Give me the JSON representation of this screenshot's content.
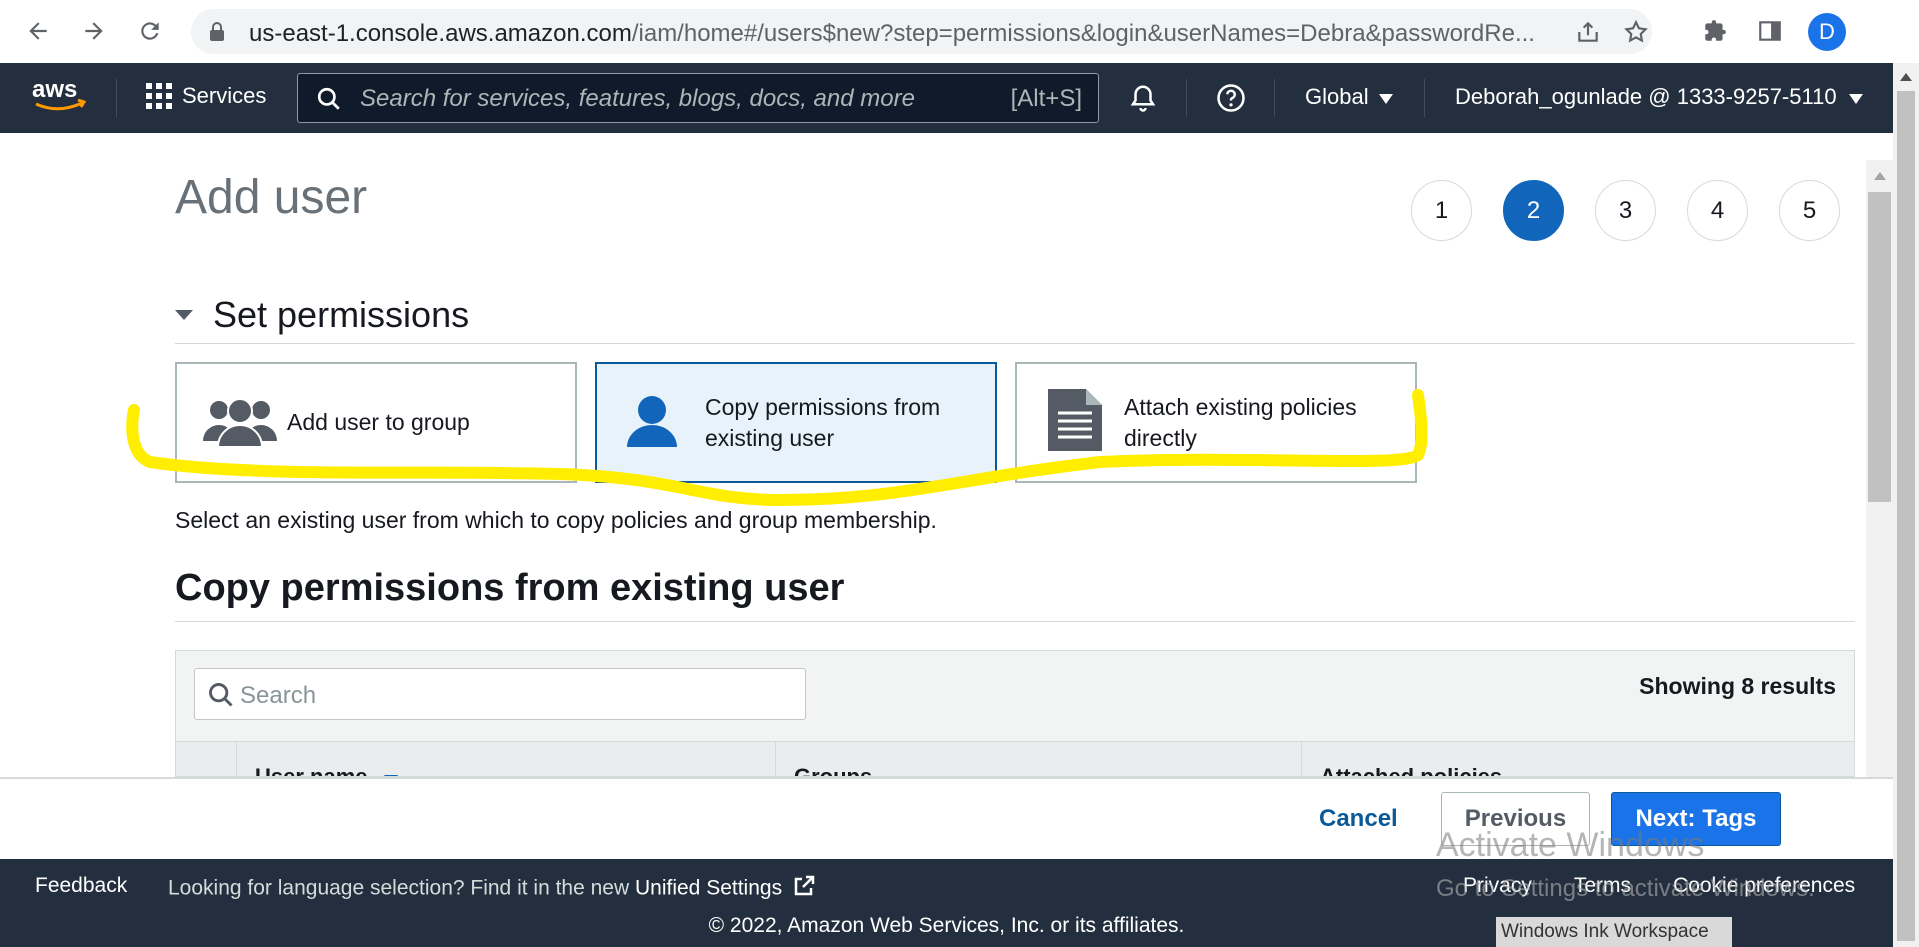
{
  "browser": {
    "url_host": "us-east-1.console.aws.amazon.com",
    "url_path": "/iam/home#/users$new?step=permissions&login&userNames=Debra&passwordRe...",
    "profile_initial": "D"
  },
  "aws_nav": {
    "services_label": "Services",
    "search_placeholder": "Search for services, features, blogs, docs, and more",
    "search_shortcut": "[Alt+S]",
    "region": "Global",
    "account": "Deborah_ogunlade @ 1333-9257-5110"
  },
  "page": {
    "title": "Add user",
    "steps": [
      "1",
      "2",
      "3",
      "4",
      "5"
    ],
    "active_step": "2",
    "section_title": "Set permissions",
    "options": [
      {
        "label": "Add user to group",
        "icon": "group-icon"
      },
      {
        "label_line1": "Copy permissions from",
        "label_line2": "existing user",
        "icon": "user-icon"
      },
      {
        "label_line1": "Attach existing policies",
        "label_line2": "directly",
        "icon": "document-icon"
      }
    ],
    "helper_text": "Select an existing user from which to copy policies and group membership.",
    "subsection_title": "Copy permissions from existing user",
    "table": {
      "search_placeholder": "Search",
      "showing": "Showing 8 results",
      "columns": [
        "User name",
        "Groups",
        "Attached policies"
      ]
    }
  },
  "actions": {
    "cancel": "Cancel",
    "previous": "Previous",
    "next": "Next: Tags"
  },
  "footer": {
    "feedback": "Feedback",
    "lang_prefix": "Looking for language selection? Find it in the new",
    "unified_settings": "Unified Settings",
    "privacy": "Privacy",
    "terms": "Terms",
    "cookie": "Cookie preferences",
    "copyright": "© 2022, Amazon Web Services, Inc. or its affiliates."
  },
  "overlay": {
    "activate_title": "Activate Windows",
    "activate_sub": "Go to Settings to activate Windows.",
    "ink_workspace": "Windows Ink Workspace"
  },
  "colors": {
    "aws_nav_bg": "#232f3e",
    "accent_blue": "#1166bb",
    "highlight_yellow": "#ffee00"
  }
}
